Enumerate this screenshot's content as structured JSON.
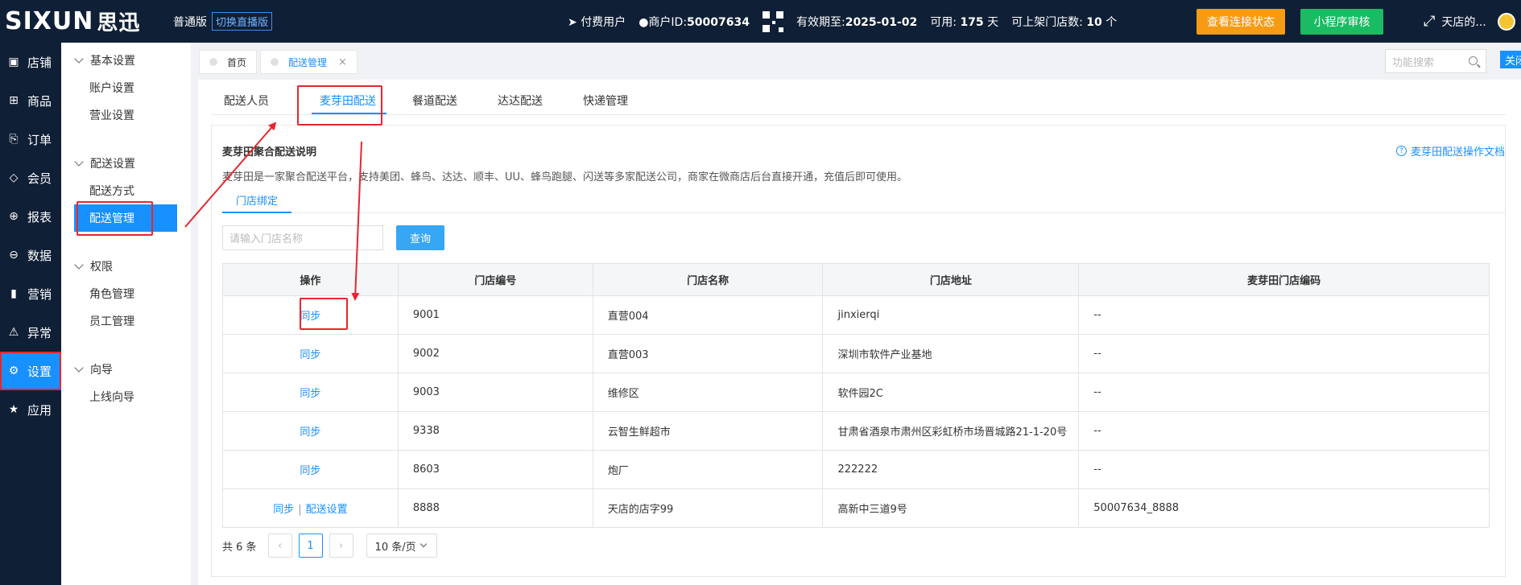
{
  "header": {
    "logo_latin": "SIXUN",
    "logo_cn": "思迅",
    "edition": "普通版",
    "switch_label": "切换直播版",
    "user_type": "付费用户",
    "merchant_label": "商户ID:",
    "merchant_id": "50007634",
    "expiry_label": "有效期至:",
    "expiry_date": "2025-01-02",
    "available_label": "可用:",
    "available_days": "175",
    "days_unit": "天",
    "stores_label": "可上架门店数:",
    "stores_count": "10",
    "stores_unit": "个",
    "btn_connection": "查看连接状态",
    "btn_miniapp": "小程序审核",
    "user_name": "天店的..."
  },
  "leftnav": [
    {
      "icon": "store-icon",
      "glyph": "▣",
      "label": "店铺"
    },
    {
      "icon": "gift-icon",
      "glyph": "⊞",
      "label": "商品"
    },
    {
      "icon": "order-icon",
      "glyph": "⎘",
      "label": "订单"
    },
    {
      "icon": "diamond-icon",
      "glyph": "◇",
      "label": "会员"
    },
    {
      "icon": "report-icon",
      "glyph": "⊕",
      "label": "报表"
    },
    {
      "icon": "data-icon",
      "glyph": "⊖",
      "label": "数据"
    },
    {
      "icon": "bar-chart-icon",
      "glyph": "▮",
      "label": "营销"
    },
    {
      "icon": "warning-icon",
      "glyph": "⚠",
      "label": "异常"
    },
    {
      "icon": "gear-icon",
      "glyph": "⚙",
      "label": "设置"
    },
    {
      "icon": "star-icon",
      "glyph": "★",
      "label": "应用"
    }
  ],
  "subnav": {
    "groups": [
      {
        "label": "基本设置",
        "items": [
          "账户设置",
          "营业设置"
        ]
      },
      {
        "label": "配送设置",
        "items": [
          "配送方式",
          "配送管理"
        ]
      },
      {
        "label": "权限",
        "items": [
          "角色管理",
          "员工管理"
        ]
      },
      {
        "label": "向导",
        "items": [
          "上线向导"
        ]
      }
    ]
  },
  "page_tabs": {
    "home": "首页",
    "current": "配送管理",
    "close_glyph": "×",
    "search_placeholder": "功能搜索",
    "close_btn": "关闭"
  },
  "delivery_tabs": [
    "配送人员",
    "麦芽田配送",
    "餐道配送",
    "达达配送",
    "快递管理"
  ],
  "panel": {
    "title": "麦芽田聚合配送说明",
    "doc_link": "麦芽田配送操作文档",
    "description": "麦芽田是一家聚合配送平台，支持美团、蜂鸟、达达、顺丰、UU、蜂鸟跑腿、闪送等多家配送公司，商家在微商店后台直接开通，充值后即可使用。",
    "sub_tab": "门店绑定",
    "store_placeholder": "请输入门店名称",
    "query_btn": "查询"
  },
  "table": {
    "headers": [
      "操作",
      "门店编号",
      "门店名称",
      "门店地址",
      "麦芽田门店编码"
    ],
    "rows": [
      {
        "op": "同步",
        "op2": "",
        "id": "9001",
        "name": "直营004",
        "address": "jinxierqi",
        "code": "--"
      },
      {
        "op": "同步",
        "op2": "",
        "id": "9002",
        "name": "直营003",
        "address": "深圳市软件产业基地",
        "code": "--"
      },
      {
        "op": "同步",
        "op2": "",
        "id": "9003",
        "name": "维修区",
        "address": "软件园2C",
        "code": "--"
      },
      {
        "op": "同步",
        "op2": "",
        "id": "9338",
        "name": "云智生鲜超市",
        "address": "甘肃省酒泉市肃州区彩虹桥市场晋城路21-1-20号",
        "code": "--"
      },
      {
        "op": "同步",
        "op2": "",
        "id": "8603",
        "name": "炮厂",
        "address": "222222",
        "code": "--"
      },
      {
        "op": "同步",
        "op2": "配送设置",
        "id": "8888",
        "name": "天店的店字99",
        "address": "高新中三道9号",
        "code": "50007634_8888"
      }
    ],
    "op_separator": "|"
  },
  "pager": {
    "total": "共 6 条",
    "prev": "‹",
    "current_page": "1",
    "next": "›",
    "page_size": "10 条/页"
  },
  "colors": {
    "header_bg": "#0f1f36",
    "accent": "#1890ff",
    "annotation_red": "#e8262d",
    "orange_btn": "#f89b14",
    "green_btn": "#19bc62"
  }
}
